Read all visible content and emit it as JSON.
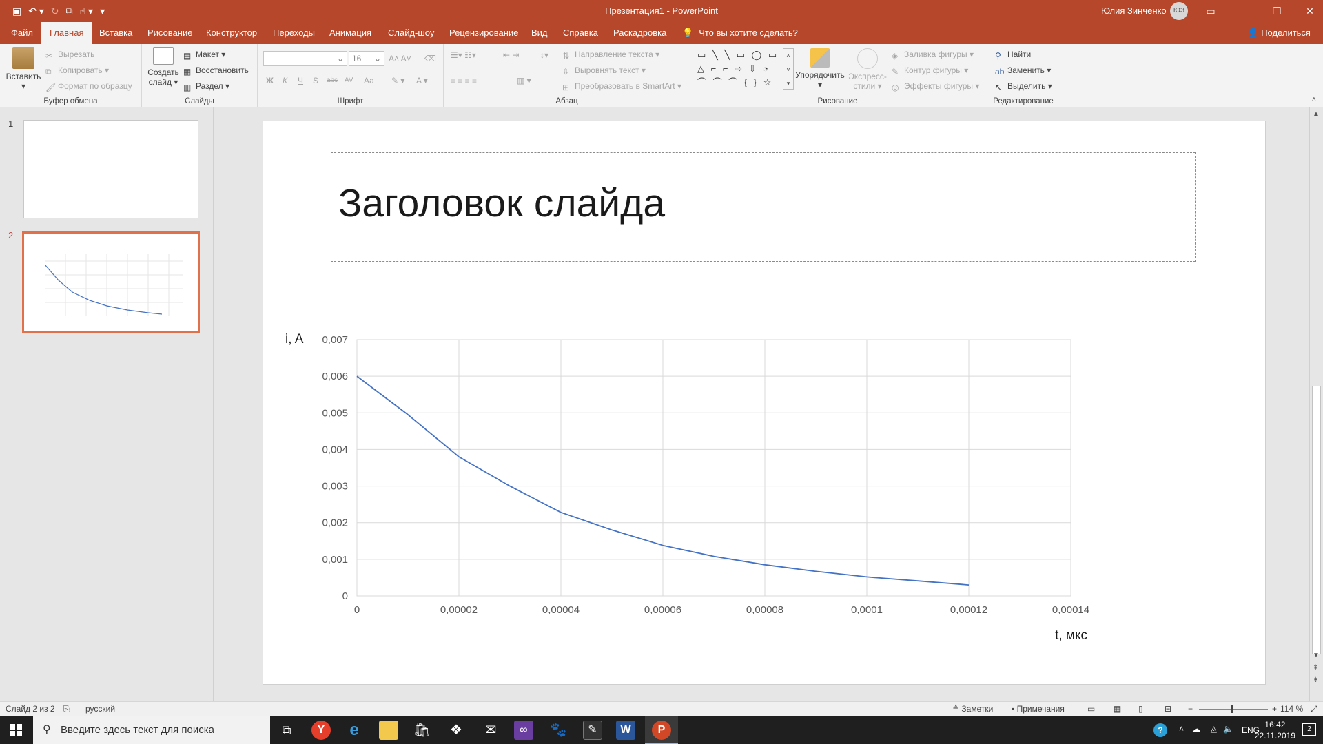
{
  "window": {
    "title": "Презентация1  -  PowerPoint",
    "user": "Юлия Зинченко",
    "avatar_initials": "ЮЗ"
  },
  "tabs": [
    {
      "label": "Файл"
    },
    {
      "label": "Главная"
    },
    {
      "label": "Вставка"
    },
    {
      "label": "Рисование"
    },
    {
      "label": "Конструктор"
    },
    {
      "label": "Переходы"
    },
    {
      "label": "Анимация"
    },
    {
      "label": "Слайд-шоу"
    },
    {
      "label": "Рецензирование"
    },
    {
      "label": "Вид"
    },
    {
      "label": "Справка"
    },
    {
      "label": "Раскадровка"
    }
  ],
  "tell_me": "Что вы хотите сделать?",
  "share": "Поделиться",
  "ribbon": {
    "clipboard": {
      "paste": "Вставить",
      "cut": "Вырезать",
      "copy": "Копировать",
      "format": "Формат по образцу",
      "label": "Буфер обмена"
    },
    "slides": {
      "new": "Создать",
      "new2": "слайд",
      "layout": "Макет",
      "reset": "Восстановить",
      "section": "Раздел",
      "label": "Слайды"
    },
    "font": {
      "size": "16",
      "bold": "Ж",
      "italic": "К",
      "underline": "Ч",
      "shadow": "S",
      "strike": "abc",
      "spacing": "AV",
      "case": "Аа",
      "label": "Шрифт"
    },
    "paragraph": {
      "direction": "Направление текста",
      "align": "Выровнять текст",
      "smartart": "Преобразовать в SmartArt",
      "label": "Абзац"
    },
    "drawing": {
      "arrange": "Упорядочить",
      "quick": "Экспресс-",
      "quick2": "стили",
      "fill": "Заливка фигуры",
      "outline": "Контур фигуры",
      "effects": "Эффекты фигуры",
      "label": "Рисование"
    },
    "editing": {
      "find": "Найти",
      "replace": "Заменить",
      "select": "Выделить",
      "label": "Редактирование"
    }
  },
  "slides_pane": [
    {
      "number": "1"
    },
    {
      "number": "2"
    }
  ],
  "slide": {
    "title": "Заголовок слайда"
  },
  "chart_data": {
    "type": "line",
    "ylabel": "i, A",
    "xlabel": "t, мкс",
    "xlim": [
      0,
      0.00014
    ],
    "ylim": [
      0,
      0.007
    ],
    "x_ticks": [
      "0",
      "0,00002",
      "0,00004",
      "0,00006",
      "0,00008",
      "0,0001",
      "0,00012",
      "0,00014"
    ],
    "y_ticks": [
      "0",
      "0,001",
      "0,002",
      "0,003",
      "0,004",
      "0,005",
      "0,006",
      "0,007"
    ],
    "grid": true,
    "series": [
      {
        "color": "#4472c4",
        "x": [
          0,
          1e-05,
          2e-05,
          3e-05,
          4e-05,
          5e-05,
          6e-05,
          7e-05,
          8e-05,
          9e-05,
          0.0001,
          0.00011,
          0.00012
        ],
        "y": [
          0.006,
          0.00495,
          0.0038,
          0.003,
          0.00228,
          0.0018,
          0.00138,
          0.00108,
          0.00085,
          0.00067,
          0.00052,
          0.00041,
          0.0003
        ]
      }
    ]
  },
  "status": {
    "slide_info": "Слайд 2 из 2",
    "language": "русский",
    "notes": "Заметки",
    "comments": "Примечания",
    "zoom": "114 %"
  },
  "taskbar": {
    "search_placeholder": "Введите здесь текст для поиска",
    "lang": "ENG",
    "time": "16:42",
    "date": "22.11.2019",
    "notif_count": "2"
  },
  "colors": {
    "accent": "#b7472a",
    "selection": "#e0714b",
    "series": "#4472c4"
  }
}
